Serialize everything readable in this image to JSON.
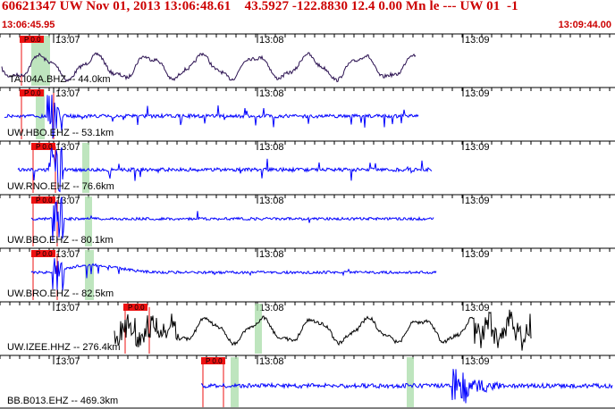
{
  "header": {
    "title": "60621347 UW Nov 01, 2013 13:06:48.61    43.5927 -122.8830 12.4 0.00 Mn le --- UW 01  -1",
    "start_time": "13:06:45.95",
    "end_time": "13:09:44.00"
  },
  "colors": {
    "header_text": "#cc0000",
    "pick": "#ee1111",
    "window": "#a8dca8",
    "trace": "#0000ff",
    "trace_alt": "#000000"
  },
  "time_ticks": [
    "13:07",
    "13:08",
    "13:09"
  ],
  "traces": [
    {
      "label": "TA.I04A.BHZ -- 44.0km",
      "pick": "P 0.0",
      "color": "#2a1050"
    },
    {
      "label": "UW.HBO.EHZ -- 53.1km",
      "pick": "P 0.0",
      "color": "#0000ff"
    },
    {
      "label": "UW.RNO.EHZ -- 76.6km",
      "pick": "P 0.0",
      "color": "#0000ff"
    },
    {
      "label": "UW.BBO.EHZ -- 80.1km",
      "pick": "P 0.0",
      "color": "#0000ff"
    },
    {
      "label": "UW.BRO.EHZ -- 82.5km",
      "pick": "P 0.0",
      "color": "#0000ff"
    },
    {
      "label": "UW.IZEE.HHZ -- 276.4km",
      "pick": "P 0.0",
      "color": "#000000"
    },
    {
      "label": "BB.B013.EHZ -- 469.3km",
      "pick": "P 0.0",
      "color": "#0000ff"
    }
  ]
}
